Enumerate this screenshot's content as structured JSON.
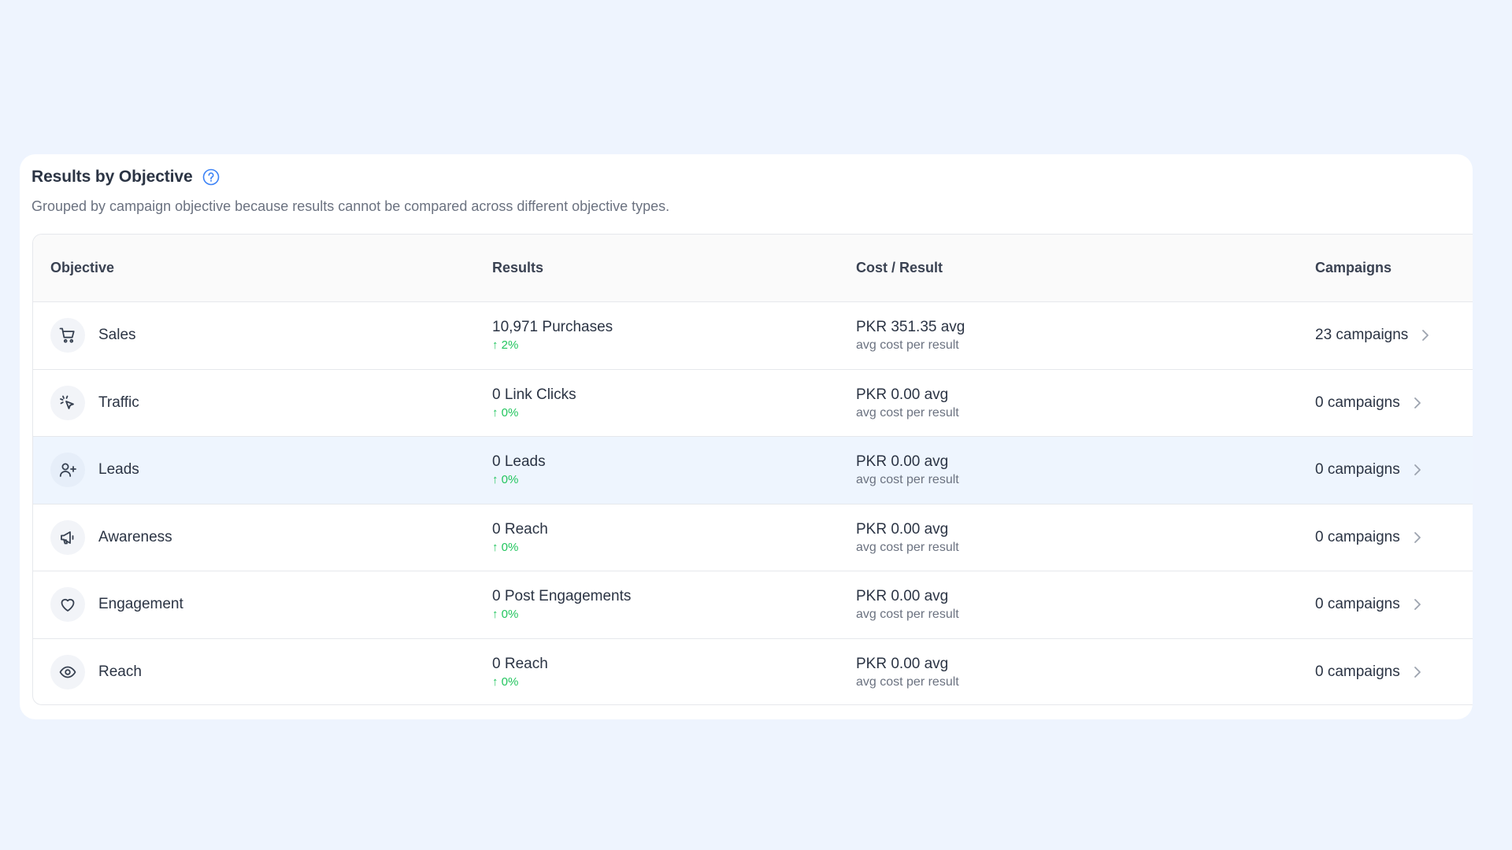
{
  "card": {
    "title": "Results by Objective",
    "help_icon": "question-circle-icon",
    "subtitle": "Grouped by campaign objective because results cannot be compared across different objective types."
  },
  "table": {
    "headers": {
      "objective": "Objective",
      "results": "Results",
      "cost": "Cost / Result",
      "campaigns": "Campaigns"
    },
    "rows": [
      {
        "icon": "cart-icon",
        "objective": "Sales",
        "results": "10,971 Purchases",
        "delta": "↑ 2%",
        "cost": "PKR 351.35 avg",
        "cost_sub": "avg cost per result",
        "campaigns": "23 campaigns",
        "highlighted": false
      },
      {
        "icon": "cursor-click-icon",
        "objective": "Traffic",
        "results": "0 Link Clicks",
        "delta": "↑ 0%",
        "cost": "PKR 0.00 avg",
        "cost_sub": "avg cost per result",
        "campaigns": "0 campaigns",
        "highlighted": false
      },
      {
        "icon": "user-plus-icon",
        "objective": "Leads",
        "results": "0 Leads",
        "delta": "↑ 0%",
        "cost": "PKR 0.00 avg",
        "cost_sub": "avg cost per result",
        "campaigns": "0 campaigns",
        "highlighted": true
      },
      {
        "icon": "megaphone-icon",
        "objective": "Awareness",
        "results": "0 Reach",
        "delta": "↑ 0%",
        "cost": "PKR 0.00 avg",
        "cost_sub": "avg cost per result",
        "campaigns": "0 campaigns",
        "highlighted": false
      },
      {
        "icon": "heart-icon",
        "objective": "Engagement",
        "results": "0 Post Engagements",
        "delta": "↑ 0%",
        "cost": "PKR 0.00 avg",
        "cost_sub": "avg cost per result",
        "campaigns": "0 campaigns",
        "highlighted": false
      },
      {
        "icon": "eye-icon",
        "objective": "Reach",
        "results": "0 Reach",
        "delta": "↑ 0%",
        "cost": "PKR 0.00 avg",
        "cost_sub": "avg cost per result",
        "campaigns": "0 campaigns",
        "highlighted": false
      }
    ]
  },
  "colors": {
    "page_background": "#eef4fe",
    "card_background": "#ffffff",
    "accent_blue": "#3b82f6",
    "delta_green": "#22c55e",
    "highlight_row": "#eef5fe"
  }
}
